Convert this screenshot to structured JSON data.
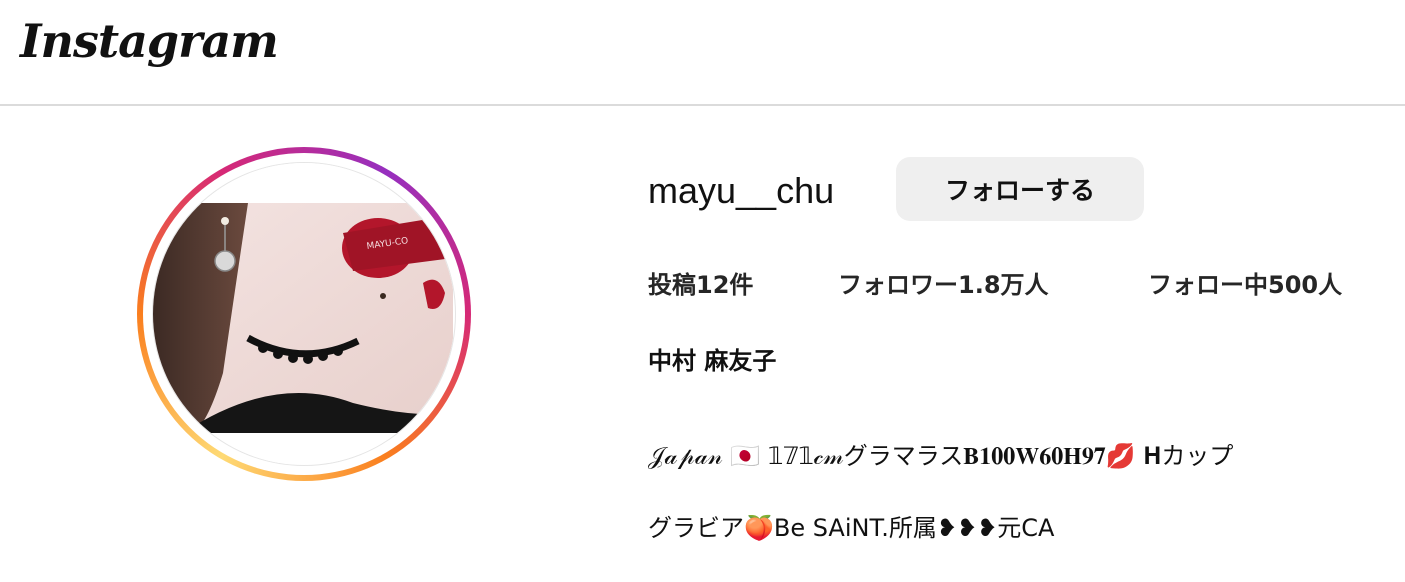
{
  "header": {
    "logo_text": "Instagram"
  },
  "profile": {
    "username": "mayu__chu",
    "follow_button_label": "フォローする",
    "avatar_description": "profile-photo",
    "stats": {
      "posts": "投稿12件",
      "followers": "フォロワー1.8万人",
      "following": "フォロー中500人"
    },
    "full_name": "中村 麻友子",
    "bio_line1": "𝒥𝒶𝓅𝒶𝓃 🇯🇵 𝟙𝟟𝟙𝒸𝓂グラマラス𝐁𝟏𝟎𝟎𝐖𝟔𝟎𝐇𝟗𝟕💋 𝐇カップ",
    "bio_line2": "グラビア🍑Be SAiNT.所属❥❥❥元CA"
  },
  "colors": {
    "ring_gradient": [
      "#feda75",
      "#fa7e1e",
      "#d62976",
      "#962fbf"
    ],
    "button_bg": "#efefef",
    "divider": "#dbdbdb"
  }
}
